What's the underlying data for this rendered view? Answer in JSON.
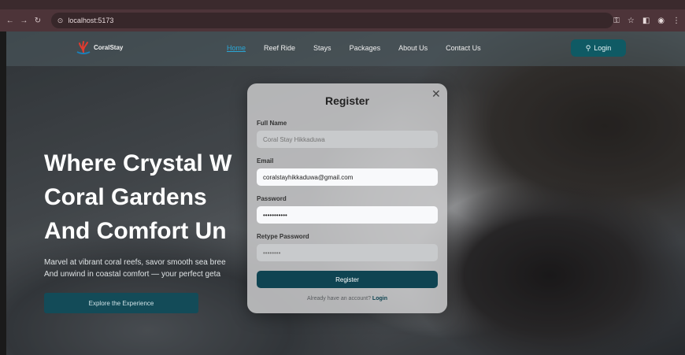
{
  "browser": {
    "url": "localhost:5173",
    "back_icon": "back-arrow-icon",
    "forward_icon": "forward-arrow-icon",
    "reload_icon": "reload-icon"
  },
  "navbar": {
    "logo_text": "CoralStay",
    "links": [
      "Home",
      "Reef Ride",
      "Stays",
      "Packages",
      "About Us",
      "Contact Us"
    ],
    "active_link": "Home",
    "login_label": "Login"
  },
  "hero": {
    "title_lines": [
      "Where Crystal W",
      "Coral Gardens",
      "And Comfort Un"
    ],
    "subtitle_lines": [
      "Marvel at vibrant coral reefs, savor smooth sea bree",
      "And unwind in coastal comfort — your perfect geta"
    ],
    "cta_label": "Explore the Experience"
  },
  "modal": {
    "title": "Register",
    "close_icon": "close-icon",
    "fields": [
      {
        "label": "Full Name",
        "value": "",
        "placeholder": "Coral Stay Hikkaduwa"
      },
      {
        "label": "Email",
        "value": "coralstayhikkaduwa@gmail.com",
        "placeholder": ""
      },
      {
        "label": "Password",
        "value": "•••••••••••",
        "placeholder": ""
      },
      {
        "label": "Retype Password",
        "value": "",
        "placeholder": "••••••••"
      }
    ],
    "submit_label": "Register",
    "footer_text": "Already have an account?",
    "footer_link": "Login"
  },
  "colors": {
    "brand_teal": "#0f5a64",
    "modal_button": "#0f4452",
    "active_link": "#2aa7d6",
    "chrome": "#4d3439"
  }
}
